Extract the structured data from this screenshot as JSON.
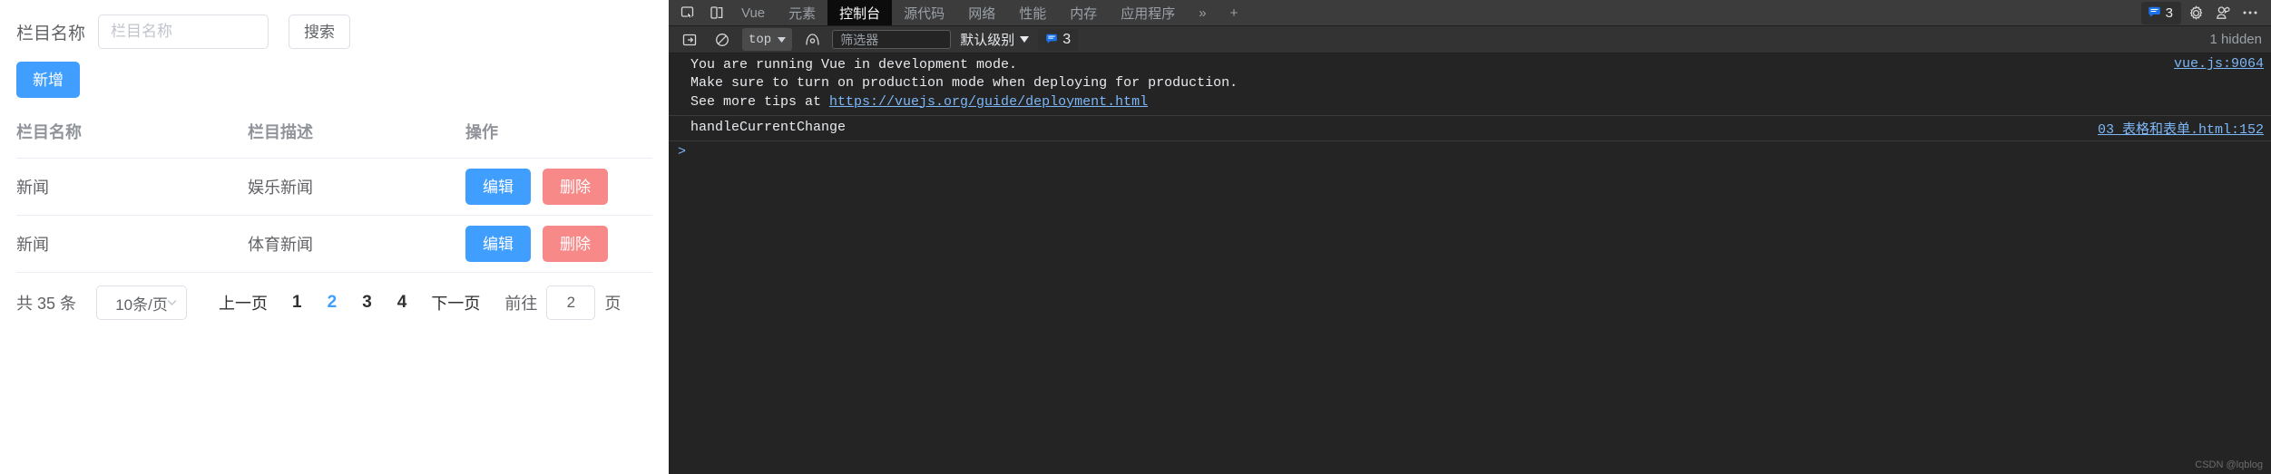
{
  "page": {
    "search": {
      "label": "栏目名称",
      "input_value": "",
      "input_placeholder": "栏目名称",
      "button_label": "搜索"
    },
    "add_button_label": "新增",
    "table": {
      "columns": [
        "栏目名称",
        "栏目描述",
        "操作"
      ],
      "rows": [
        {
          "name": "新闻",
          "desc": "娱乐新闻",
          "edit": "编辑",
          "delete": "删除"
        },
        {
          "name": "新闻",
          "desc": "体育新闻",
          "edit": "编辑",
          "delete": "删除"
        }
      ]
    },
    "pagination": {
      "total_text": "共 35 条",
      "page_size": "10条/页",
      "prev_label": "上一页",
      "pages": [
        "1",
        "2",
        "3",
        "4"
      ],
      "active_page": "2",
      "next_label": "下一页",
      "jump_label": "前往",
      "jump_value": "2",
      "jump_suffix": "页"
    },
    "colors": {
      "primary": "#409eff",
      "danger": "#f78989",
      "border": "#dcdfe6",
      "text": "#606266"
    }
  },
  "devtools": {
    "tabs": [
      {
        "label": "Vue",
        "active": false
      },
      {
        "label": "元素",
        "active": false
      },
      {
        "label": "控制台",
        "active": true
      },
      {
        "label": "源代码",
        "active": false
      },
      {
        "label": "网络",
        "active": false
      },
      {
        "label": "性能",
        "active": false
      },
      {
        "label": "内存",
        "active": false
      },
      {
        "label": "应用程序",
        "active": false
      }
    ],
    "more_tabs_label": "»",
    "add_tab_label": "+",
    "issues_count": "3",
    "console_bar": {
      "context": "top",
      "filter_value": "",
      "filter_placeholder": "筛选器",
      "level_label": "默认级别",
      "message_count": "3",
      "hidden_text": "1 hidden"
    },
    "messages": [
      {
        "lines": [
          "You are running Vue in development mode.",
          "Make sure to turn on production mode when deploying for production.",
          "See more tips at "
        ],
        "link_text": "https://vuejs.org/guide/deployment.html",
        "source": "vue.js:9064"
      },
      {
        "lines": [
          "handleCurrentChange"
        ],
        "link_text": "",
        "source": "03 表格和表单.html:152"
      }
    ],
    "prompt_symbol": ">",
    "watermark": "CSDN @lqblog",
    "colors": {
      "bg": "#242424",
      "tabbar": "#3c3c3c",
      "link": "#7cb7f7",
      "accent": "#1a73e8"
    }
  }
}
